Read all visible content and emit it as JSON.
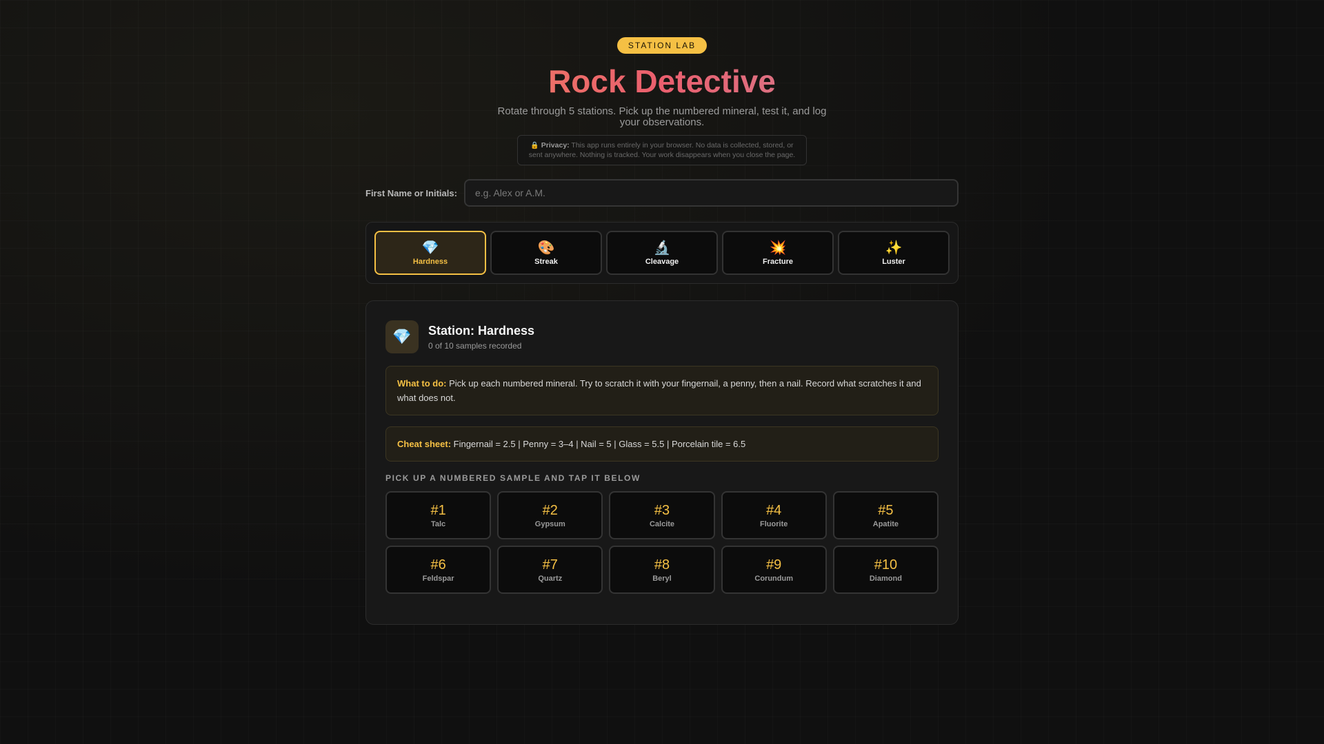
{
  "header": {
    "badge": "STATION LAB",
    "title": "Rock Detective",
    "subtitle": "Rotate through 5 stations. Pick up the numbered mineral, test it, and log your observations.",
    "privacy_icon": "lock-icon",
    "privacy_label": "Privacy:",
    "privacy_text": " This app runs entirely in your browser. No data is collected, stored, or sent anywhere. Nothing is tracked. Your work disappears when you close the page."
  },
  "name_field": {
    "label": "First Name or Initials:",
    "value": "",
    "placeholder": "e.g. Alex or A.M."
  },
  "tabs": [
    {
      "icon": "💎",
      "icon_name": "gem-icon",
      "label": "Hardness",
      "active": true
    },
    {
      "icon": "🎨",
      "icon_name": "palette-icon",
      "label": "Streak",
      "active": false
    },
    {
      "icon": "🔬",
      "icon_name": "microscope-icon",
      "label": "Cleavage",
      "active": false
    },
    {
      "icon": "💥",
      "icon_name": "collision-icon",
      "label": "Fracture",
      "active": false
    },
    {
      "icon": "✨",
      "icon_name": "sparkles-icon",
      "label": "Luster",
      "active": false
    }
  ],
  "station": {
    "icon": "💎",
    "title": "Station: Hardness",
    "count": "0 of 10 samples recorded",
    "todo_label": "What to do:",
    "todo_text": " Pick up each numbered mineral. Try to scratch it with your fingernail, a penny, then a nail. Record what scratches it and what does not.",
    "cheat_label": "Cheat sheet:",
    "cheat_text": " Fingernail = 2.5 | Penny = 3–4 | Nail = 5 | Glass = 5.5 | Porcelain tile = 6.5",
    "section_label": "PICK UP A NUMBERED SAMPLE AND TAP IT BELOW"
  },
  "samples": [
    {
      "num": "#1",
      "name": "Talc"
    },
    {
      "num": "#2",
      "name": "Gypsum"
    },
    {
      "num": "#3",
      "name": "Calcite"
    },
    {
      "num": "#4",
      "name": "Fluorite"
    },
    {
      "num": "#5",
      "name": "Apatite"
    },
    {
      "num": "#6",
      "name": "Feldspar"
    },
    {
      "num": "#7",
      "name": "Quartz"
    },
    {
      "num": "#8",
      "name": "Beryl"
    },
    {
      "num": "#9",
      "name": "Corundum"
    },
    {
      "num": "#10",
      "name": "Diamond"
    }
  ],
  "colors": {
    "accent": "#f5c044",
    "background": "#101010",
    "title_gradient_start": "#f08a5d",
    "title_gradient_end": "#c98ba0"
  }
}
